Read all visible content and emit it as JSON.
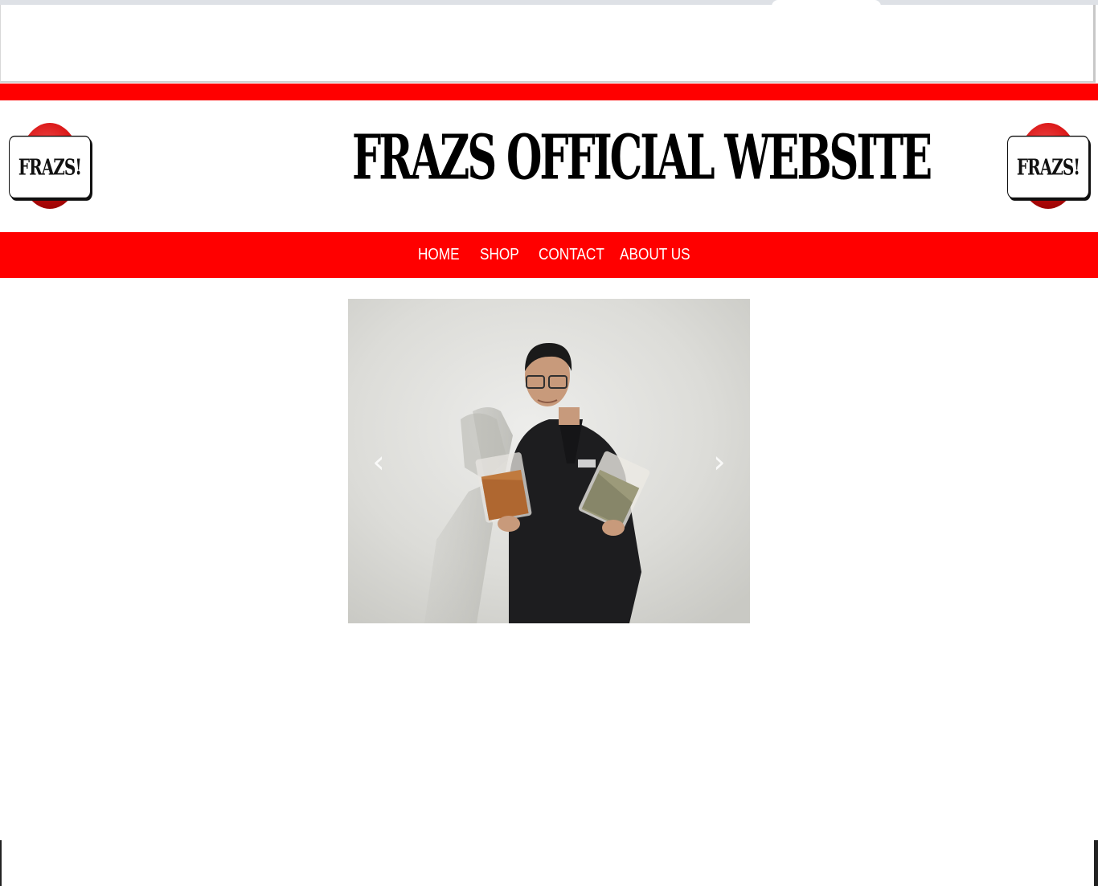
{
  "site": {
    "title": "FRAZS OFFICIAL WEBSITE",
    "logo_text": "FRAZS!"
  },
  "nav": {
    "items": [
      {
        "label": "HOME"
      },
      {
        "label": "SHOP"
      },
      {
        "label": "CONTACT"
      },
      {
        "label": "ABOUT US"
      }
    ]
  },
  "carousel": {
    "prev_icon": "chevron-left-icon",
    "next_icon": "chevron-right-icon",
    "prev_glyph": "‹",
    "next_glyph": "›"
  },
  "colors": {
    "brand_red": "#ff0000",
    "nav_text": "#ffffff",
    "title_text": "#000000"
  }
}
